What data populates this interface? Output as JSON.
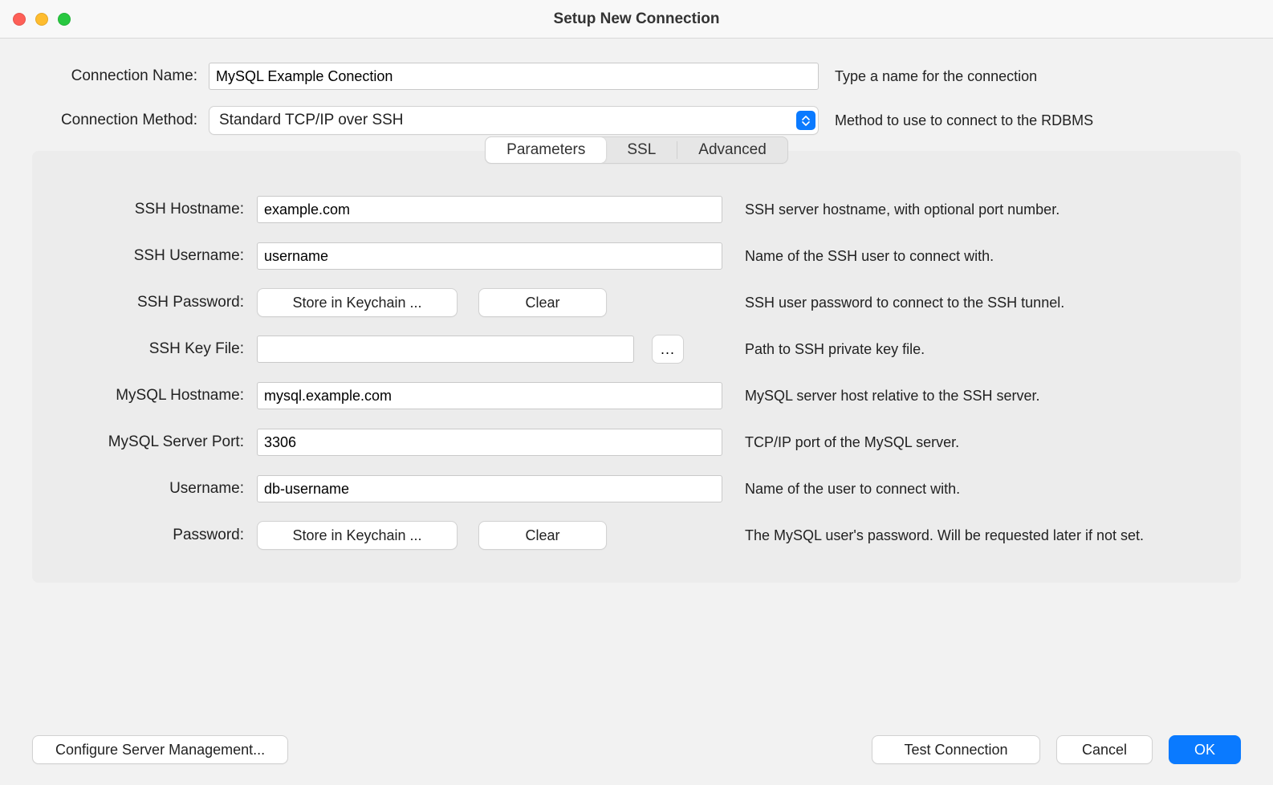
{
  "window": {
    "title": "Setup New Connection"
  },
  "header": {
    "connection_name_label": "Connection Name:",
    "connection_name_value": "MySQL Example Conection",
    "connection_name_helper": "Type a name for the connection",
    "connection_method_label": "Connection Method:",
    "connection_method_value": "Standard TCP/IP over SSH",
    "connection_method_helper": "Method to use to connect to the RDBMS"
  },
  "tabs": {
    "parameters": "Parameters",
    "ssl": "SSL",
    "advanced": "Advanced"
  },
  "fields": {
    "ssh_hostname": {
      "label": "SSH Hostname:",
      "value": "example.com",
      "helper": "SSH server hostname, with  optional port number."
    },
    "ssh_username": {
      "label": "SSH Username:",
      "value": "username",
      "helper": "Name of the SSH user to connect with."
    },
    "ssh_password": {
      "label": "SSH Password:",
      "store": "Store in Keychain ...",
      "clear": "Clear",
      "helper": "SSH user password to connect to the SSH tunnel."
    },
    "ssh_keyfile": {
      "label": "SSH Key File:",
      "value": "",
      "browse": "...",
      "helper": "Path to SSH private key file."
    },
    "mysql_hostname": {
      "label": "MySQL Hostname:",
      "value": "mysql.example.com",
      "helper": "MySQL server host relative to the SSH server."
    },
    "mysql_port": {
      "label": "MySQL Server Port:",
      "value": "3306",
      "helper": "TCP/IP port of the MySQL server."
    },
    "username": {
      "label": "Username:",
      "value": "db-username",
      "helper": "Name of the user to connect with."
    },
    "password": {
      "label": "Password:",
      "store": "Store in Keychain ...",
      "clear": "Clear",
      "helper": "The MySQL user's password. Will be requested later if not set."
    }
  },
  "footer": {
    "configure": "Configure Server Management...",
    "test": "Test Connection",
    "cancel": "Cancel",
    "ok": "OK"
  }
}
